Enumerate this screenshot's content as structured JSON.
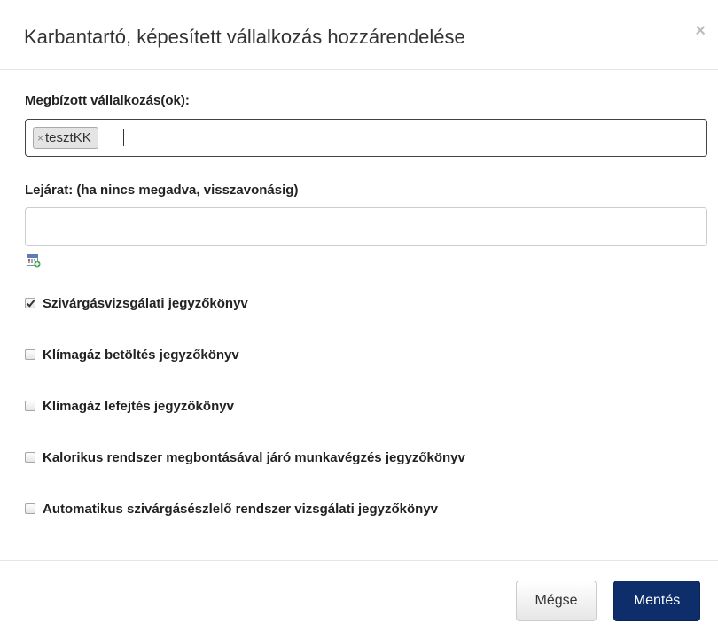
{
  "dialog": {
    "title": "Karbantartó, képesített vállalkozás hozzárendelése",
    "close_symbol": "×"
  },
  "contractors": {
    "label": "Megbízott vállalkozás(ok):",
    "tags": [
      {
        "remove_symbol": "×",
        "text": "tesztKK"
      }
    ]
  },
  "expiry": {
    "label": "Lejárat: (ha nincs megadva, visszavonásig)",
    "value": "",
    "placeholder": "",
    "icon": "calendar-add-icon"
  },
  "reports": [
    {
      "label": "Szivárgásvizsgálati jegyzőkönyv",
      "checked": true
    },
    {
      "label": "Klímagáz betöltés jegyzőkönyv",
      "checked": false
    },
    {
      "label": "Klímagáz lefejtés jegyzőkönyv",
      "checked": false
    },
    {
      "label": "Kalorikus rendszer megbontásával járó munkavégzés jegyzőkönyv",
      "checked": false
    },
    {
      "label": "Automatikus szivárgásészlelő rendszer vizsgálati jegyzőkönyv",
      "checked": false
    }
  ],
  "footer": {
    "cancel_label": "Mégse",
    "save_label": "Mentés"
  },
  "colors": {
    "primary_button": "#0d2d6b",
    "tag_background": "#e4e4e4"
  }
}
